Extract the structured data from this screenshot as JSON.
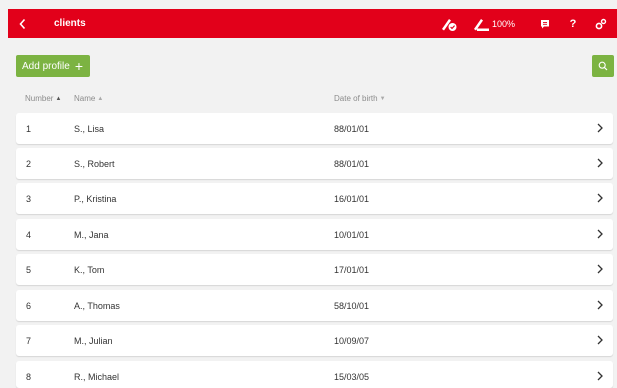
{
  "header": {
    "title": "clients",
    "battery_label": "100%",
    "accent_color": "#e2001a"
  },
  "toolbar": {
    "add_profile_label": "Add profile",
    "add_icon": "plus-icon",
    "search_icon": "search-icon",
    "button_color": "#7cb342"
  },
  "columns": {
    "number": "Number",
    "name": "Name",
    "dob": "Date of birth"
  },
  "rows": [
    {
      "number": "1",
      "name": "S., Lisa",
      "dob": "88/01/01"
    },
    {
      "number": "2",
      "name": "S., Robert",
      "dob": "88/01/01"
    },
    {
      "number": "3",
      "name": "P., Kristina",
      "dob": "16/01/01"
    },
    {
      "number": "4",
      "name": "M., Jana",
      "dob": "10/01/01"
    },
    {
      "number": "5",
      "name": "K., Tom",
      "dob": "17/01/01"
    },
    {
      "number": "6",
      "name": "A., Thomas",
      "dob": "58/10/01"
    },
    {
      "number": "7",
      "name": "M., Julian",
      "dob": "10/09/07"
    },
    {
      "number": "8",
      "name": "R., Michael",
      "dob": "15/03/05"
    }
  ]
}
